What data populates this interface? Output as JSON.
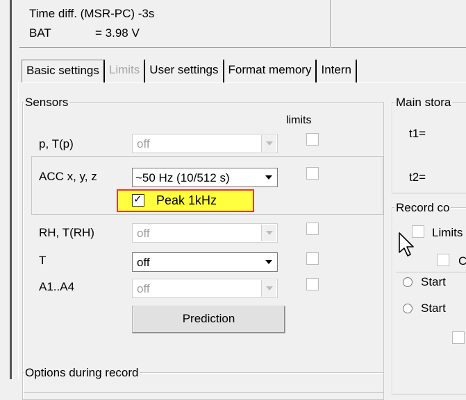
{
  "info": {
    "time_diff": "Time diff. (MSR-PC) -3s",
    "bat_label": "BAT",
    "bat_value": "= 3.98 V"
  },
  "tabs": [
    {
      "label": "Basic settings",
      "state": "active"
    },
    {
      "label": "Limits",
      "state": "disabled"
    },
    {
      "label": "User settings",
      "state": "normal"
    },
    {
      "label": "Format memory",
      "state": "normal"
    },
    {
      "label": "Intern",
      "state": "normal"
    }
  ],
  "sensors": {
    "title": "Sensors",
    "limits_header": "limits",
    "rows": [
      {
        "label": "p, T(p)",
        "value": "off"
      },
      {
        "label": "ACC x, y, z",
        "value": "~50 Hz (10/512 s)"
      },
      {
        "label": "RH, T(RH)",
        "value": "off"
      },
      {
        "label": "T",
        "value": "off"
      },
      {
        "label": "A1..A4",
        "value": "off"
      }
    ],
    "peak_label": "Peak 1kHz",
    "prediction_button": "Prediction"
  },
  "options_title": "Options during record",
  "main_storage": {
    "title": "Main stora",
    "t1": "t1=",
    "t2": "t2="
  },
  "record": {
    "title": "Record co",
    "limits_label": "Limits",
    "sub_letter": "C",
    "start_1": "Start",
    "start_2": "Start"
  },
  "colors": {
    "highlight_fill": "#ffff40",
    "highlight_border": "#e53935"
  }
}
